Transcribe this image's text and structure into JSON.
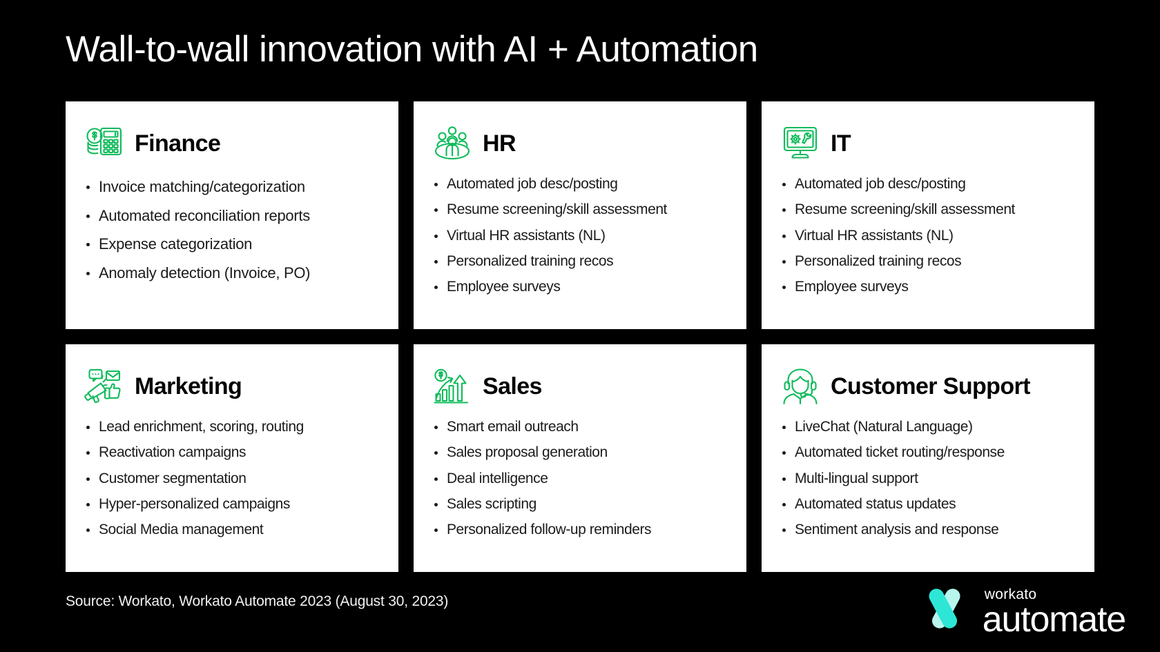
{
  "slide": {
    "title": "Wall-to-wall innovation with AI + Automation",
    "background_color": "#000000",
    "accent_green": "#0FBB5A",
    "card_background": "#FFFFFF",
    "logo_teal": "#2EE6D6",
    "logo_mint": "#B8F5EC"
  },
  "cards": [
    {
      "id": "finance",
      "icon": "finance-coins-calculator-icon",
      "title": "Finance",
      "items": [
        "Invoice matching/categorization",
        "Automated reconciliation reports",
        "Expense categorization",
        "Anomaly detection (Invoice, PO)"
      ]
    },
    {
      "id": "hr",
      "icon": "hr-people-group-icon",
      "title": "HR",
      "items": [
        "Automated job desc/posting",
        "Resume screening/skill assessment",
        "Virtual HR assistants (NL)",
        "Personalized training recos",
        "Employee surveys"
      ]
    },
    {
      "id": "it",
      "icon": "it-monitor-gear-wrench-icon",
      "title": "IT",
      "items": [
        "Automated job desc/posting",
        "Resume screening/skill assessment",
        "Virtual HR assistants (NL)",
        "Personalized training recos",
        "Employee surveys"
      ]
    },
    {
      "id": "marketing",
      "icon": "marketing-megaphone-icon",
      "title": "Marketing",
      "items": [
        "Lead enrichment, scoring, routing",
        "Reactivation campaigns",
        "Customer segmentation",
        "Hyper-personalized campaigns",
        "Social Media management"
      ]
    },
    {
      "id": "sales",
      "icon": "sales-growth-chart-icon",
      "title": "Sales",
      "items": [
        "Smart email outreach",
        "Sales proposal generation",
        "Deal intelligence",
        "Sales scripting",
        "Personalized follow-up reminders"
      ]
    },
    {
      "id": "customer-support",
      "icon": "customer-support-headset-icon",
      "title": "Customer Support",
      "items": [
        "LiveChat (Natural Language)",
        "Automated ticket routing/response",
        "Multi-lingual support",
        "Automated status updates",
        "Sentiment analysis and response"
      ]
    }
  ],
  "footer": {
    "source": "Source: Workato, Workato Automate 2023 (August 30, 2023)",
    "logo": {
      "mark": "workato-a-mark-icon",
      "brand": "workato",
      "product": "automate"
    }
  }
}
